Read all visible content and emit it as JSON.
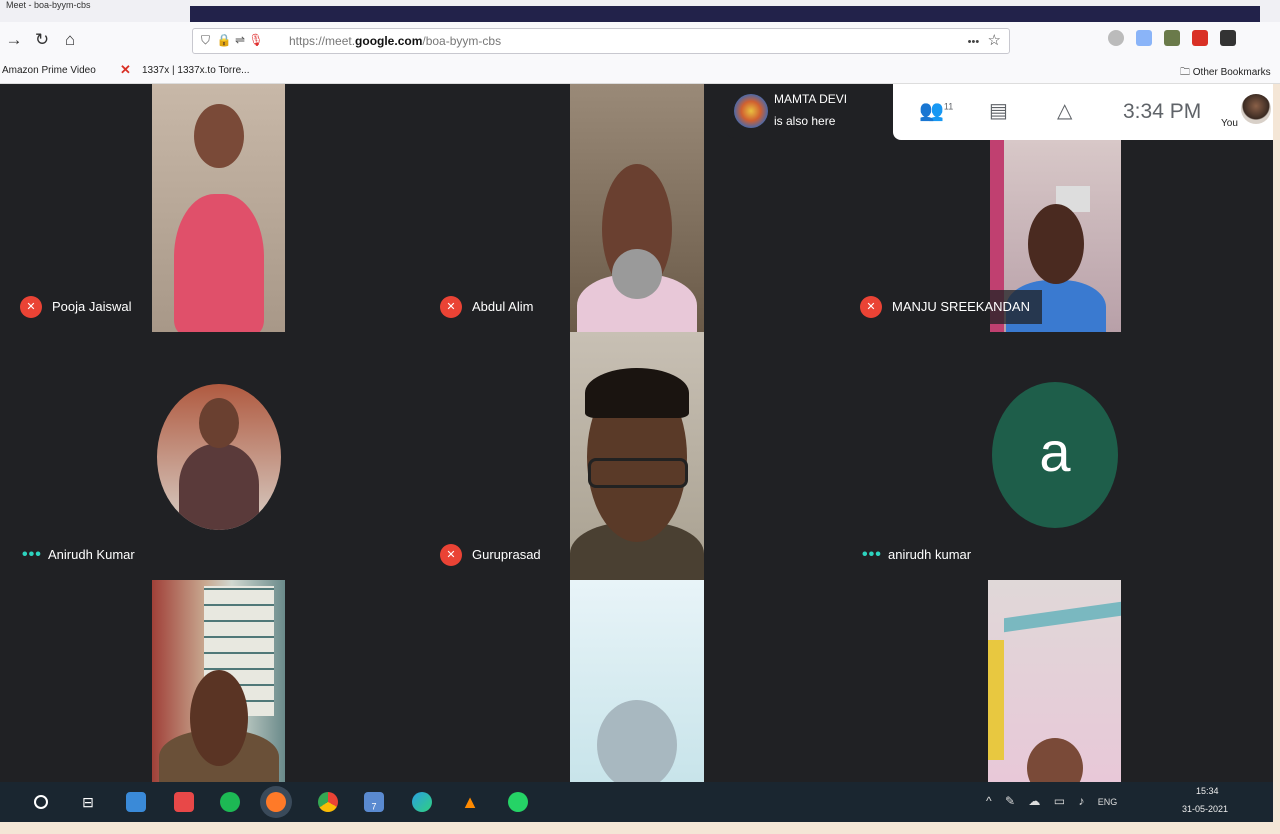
{
  "browser": {
    "tab_title": "Meet - boa-byym-cbs",
    "url_prefix": "https://meet.",
    "url_domain": "google.com",
    "url_path": "/boa-byym-cbs",
    "url_more": "•••",
    "bookmarks": {
      "amazon": "Amazon Prime Video",
      "torrent": "1337x | 1337x.to Torre...",
      "other": "Other Bookmarks"
    }
  },
  "meet": {
    "notification": {
      "name": "MAMTA DEVI",
      "sub": "is also here"
    },
    "participants_count": "11",
    "clock": "3:34 PM",
    "you_label": "You",
    "tiles": [
      {
        "name": "Pooja Jaiswal",
        "muted": true
      },
      {
        "name": "Abdul Alim",
        "muted": true
      },
      {
        "name": "MANJU SREEKANDAN",
        "muted": true
      },
      {
        "name": "Anirudh Kumar",
        "muted": false
      },
      {
        "name": "Guruprasad",
        "muted": true
      },
      {
        "name": "anirudh kumar",
        "muted": false,
        "avatar_letter": "a"
      }
    ]
  },
  "taskbar": {
    "tray_lang": "ENG",
    "time": "15:34",
    "date": "31-05-2021",
    "mail_badge": "7"
  },
  "colors": {
    "meet_bg": "#202124",
    "mute_red": "#ea4335",
    "avatar_green": "#1e5e4a",
    "dots_teal": "#2dd4bf"
  }
}
